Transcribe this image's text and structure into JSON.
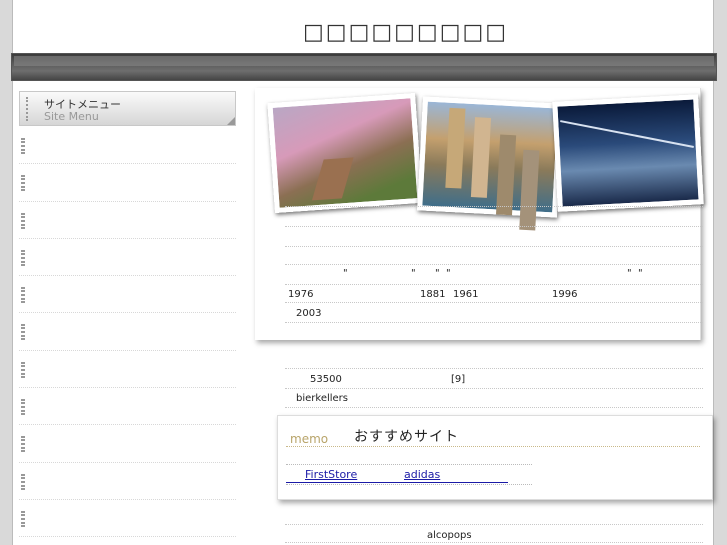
{
  "header": {
    "title": "□□□□□□□□□"
  },
  "sidebar": {
    "heading_jp": "サイトメニュー",
    "heading_en": "Site Menu",
    "item_count": 11
  },
  "article": {
    "quote_marks_row": [
      "\"",
      "\"",
      "\"",
      "\"",
      "\"",
      "\""
    ],
    "year_row": [
      "1976",
      "1881",
      "1961",
      "1996"
    ],
    "year_2003": "2003",
    "number_53500": "53500",
    "footnote": "[9]",
    "word_bierkellers": "bierkellers",
    "word_alcopops": "alcopops"
  },
  "memo": {
    "label": "memo",
    "title": "おすすめサイト",
    "links": [
      "FirstStore",
      "adidas"
    ]
  }
}
